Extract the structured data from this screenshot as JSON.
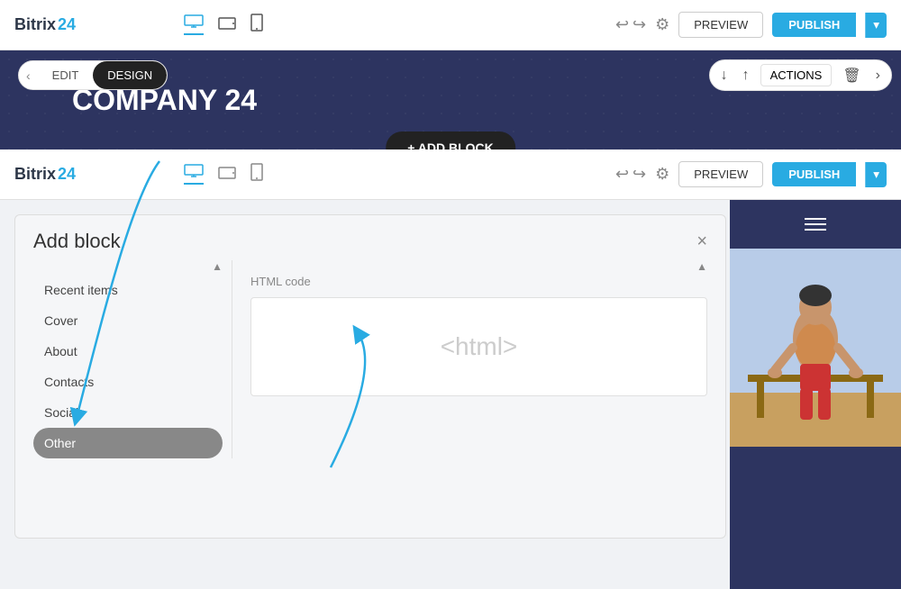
{
  "brand": {
    "name": "Bitrix",
    "accent": " 24"
  },
  "top_navbar": {
    "edit_label": "EDIT",
    "design_label": "DESIGN",
    "preview_label": "PREVIEW",
    "publish_label": "PUBLISH",
    "actions_label": "ACTIONS"
  },
  "hero": {
    "title": "COMPANY 24",
    "add_block_label": "+ ADD BLOCK"
  },
  "dialog": {
    "title": "Add block",
    "close_label": "×",
    "categories": [
      {
        "label": "Recent items",
        "active": false
      },
      {
        "label": "Cover",
        "active": false
      },
      {
        "label": "About",
        "active": false
      },
      {
        "label": "Contacts",
        "active": false
      },
      {
        "label": "Social",
        "active": false
      },
      {
        "label": "Other",
        "active": true
      }
    ],
    "content_section": {
      "title": "HTML code",
      "html_tag": "<html>"
    }
  }
}
